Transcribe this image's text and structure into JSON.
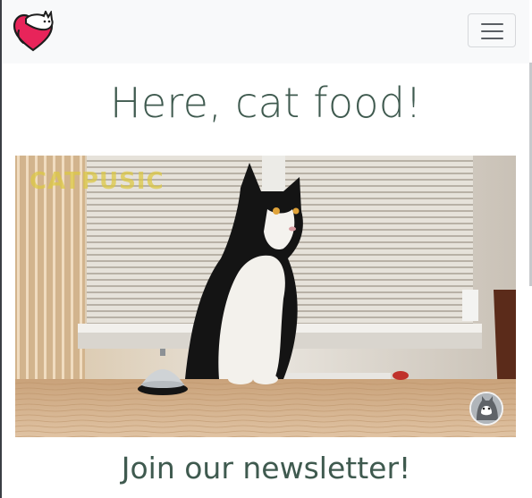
{
  "navbar": {
    "logo_icon": "cat-heart-logo-icon",
    "menu_icon": "hamburger-menu-icon",
    "menu_label": "Toggle navigation"
  },
  "hero": {
    "title": "Here, cat food!"
  },
  "video": {
    "watermark": "CATPUSIC",
    "channel_avatar_icon": "cat-avatar-icon",
    "subject": "cat-video-player"
  },
  "newsletter": {
    "heading": "Join our newsletter!"
  },
  "colors": {
    "navbar_bg": "#f8f9fa",
    "heading_text": "#3f5a4f",
    "logo_heart": "#e8245a"
  }
}
